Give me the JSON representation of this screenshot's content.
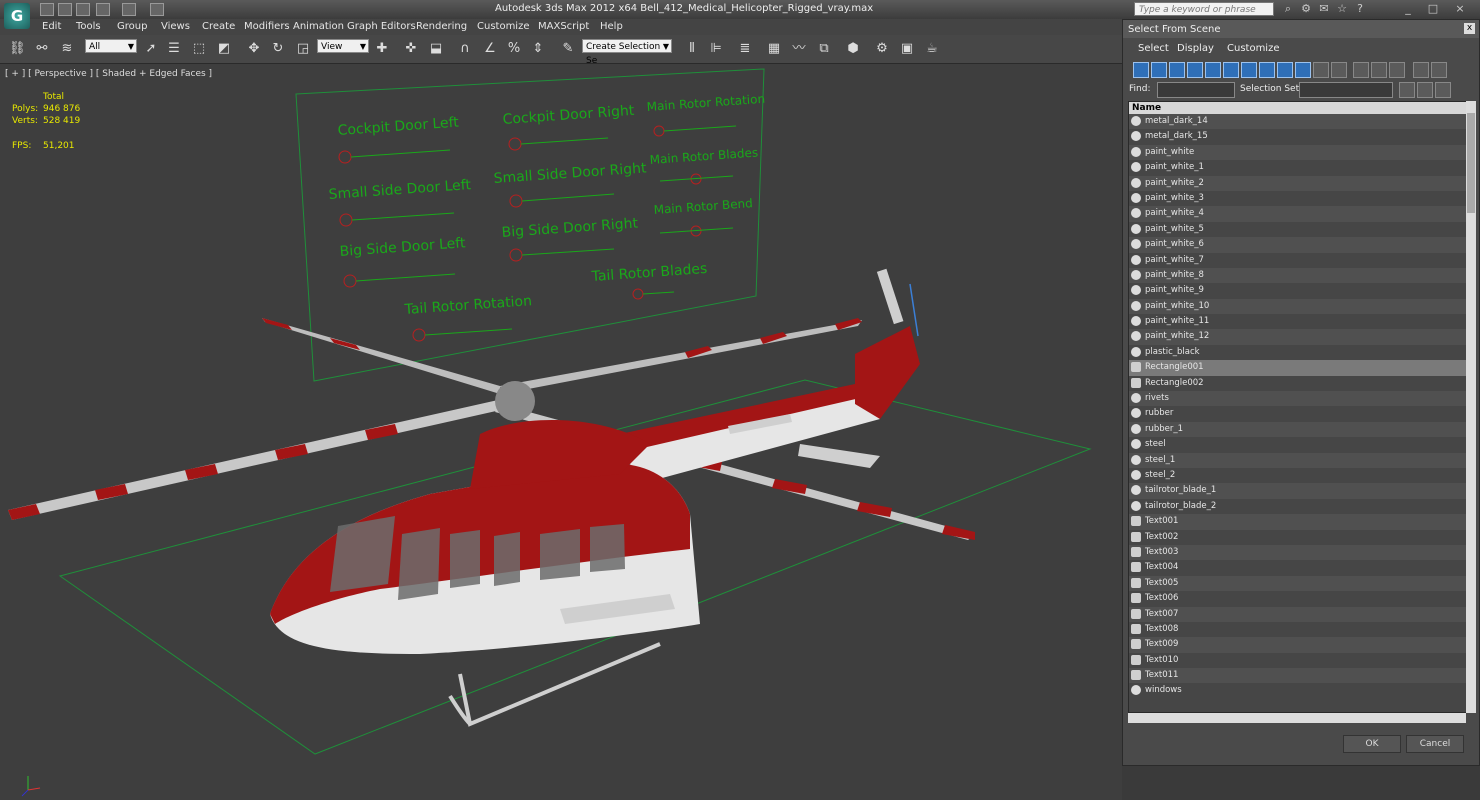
{
  "window": {
    "title": "Autodesk 3ds Max  2012 x64      Bell_412_Medical_Helicopter_Rigged_vray.max",
    "search_placeholder": "Type a keyword or phrase",
    "app_logo": "3ds-max-logo"
  },
  "menu": [
    "Edit",
    "Tools",
    "Group",
    "Views",
    "Create",
    "Modifiers",
    "Animation",
    "Graph Editors",
    "Rendering",
    "Customize",
    "MAXScript",
    "Help"
  ],
  "toolbar": {
    "filter_value": "All",
    "refcoord_value": "View",
    "selection_set_placeholder": "Create Selection Se"
  },
  "viewport": {
    "label": "[ + ] [ Perspective ] [ Shaded + Edged Faces ]",
    "stats": {
      "header": "Total",
      "polys_label": "Polys:",
      "polys_value": "946 876",
      "verts_label": "Verts:",
      "verts_value": "528 419",
      "fps_label": "FPS:",
      "fps_value": "51,201"
    },
    "rig_labels": {
      "l1": "Cockpit Door Left",
      "l2": "Cockpit Door Right",
      "l3": "Main Rotor Rotation",
      "l4": "Small Side Door Left",
      "l5": "Small Side Door Right",
      "l6": "Main Rotor Blades",
      "l7": "Big Side Door Left",
      "l8": "Big Side Door Right",
      "l9": "Main Rotor Bend",
      "l10": "Tail Rotor Rotation",
      "l11": "Tail Rotor Blades"
    },
    "colors": {
      "rig_text": "#1aa81a",
      "body_red": "#a31515",
      "body_white": "#e6e6e6",
      "grid": "#1f8f3a"
    }
  },
  "dialog": {
    "title": "Select From Scene",
    "close_glyph": "x",
    "menu": [
      "Select",
      "Display",
      "Customize"
    ],
    "find_label": "Find:",
    "selection_set_label": "Selection Set:",
    "column_header": "Name",
    "items": [
      "metal_dark_14",
      "metal_dark_15",
      "paint_white",
      "paint_white_1",
      "paint_white_2",
      "paint_white_3",
      "paint_white_4",
      "paint_white_5",
      "paint_white_6",
      "paint_white_7",
      "paint_white_8",
      "paint_white_9",
      "paint_white_10",
      "paint_white_11",
      "paint_white_12",
      "plastic_black",
      "Rectangle001",
      "Rectangle002",
      "rivets",
      "rubber",
      "rubber_1",
      "steel",
      "steel_1",
      "steel_2",
      "tailrotor_blade_1",
      "tailrotor_blade_2",
      "Text001",
      "Text002",
      "Text003",
      "Text004",
      "Text005",
      "Text006",
      "Text007",
      "Text008",
      "Text009",
      "Text010",
      "Text011",
      "windows"
    ],
    "selected_item": "Rectangle001",
    "ok_label": "OK",
    "cancel_label": "Cancel"
  }
}
